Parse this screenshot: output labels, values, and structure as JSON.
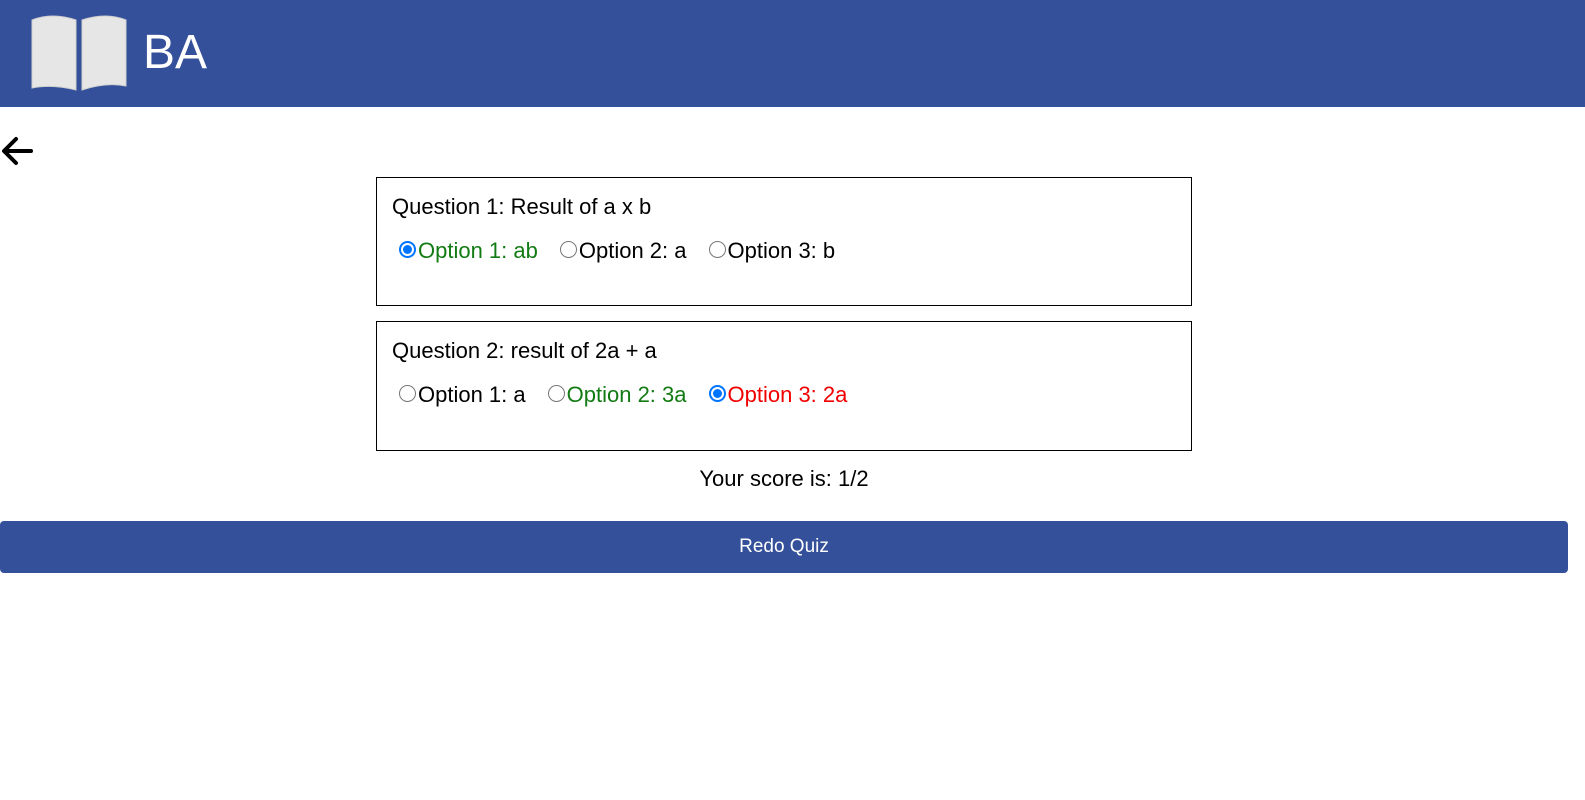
{
  "header": {
    "brand": "BA",
    "logo_icon": "open-book-icon",
    "background": "#34509a"
  },
  "nav": {
    "back_icon": "arrow-left-icon"
  },
  "questions": [
    {
      "text": "Question 1: Result of a x b",
      "options": [
        {
          "label": "Option 1: ab",
          "selected": true,
          "status": "correct",
          "color": "#137b13"
        },
        {
          "label": "Option 2: a",
          "selected": false,
          "status": "none",
          "color": "#000000"
        },
        {
          "label": "Option 3: b",
          "selected": false,
          "status": "none",
          "color": "#000000"
        }
      ]
    },
    {
      "text": "Question 2: result of 2a + a",
      "options": [
        {
          "label": "Option 1: a",
          "selected": false,
          "status": "none",
          "color": "#000000"
        },
        {
          "label": "Option 2: 3a",
          "selected": false,
          "status": "correct",
          "color": "#137b13"
        },
        {
          "label": "Option 3: 2a",
          "selected": true,
          "status": "wrong",
          "color": "#f00000"
        }
      ]
    }
  ],
  "score": {
    "text": "Your score is: 1/2"
  },
  "redo": {
    "label": "Redo Quiz"
  }
}
